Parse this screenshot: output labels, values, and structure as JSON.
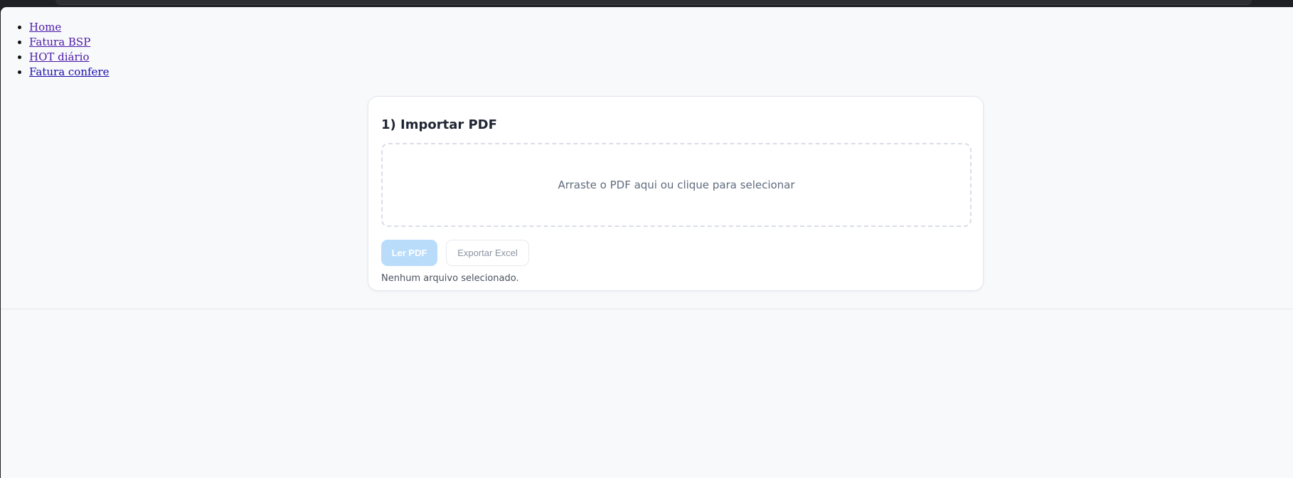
{
  "nav": {
    "items": [
      {
        "label": "Home"
      },
      {
        "label": "Fatura BSP"
      },
      {
        "label": "HOT diário"
      },
      {
        "label": "Fatura confere"
      }
    ]
  },
  "import_card": {
    "title": "1) Importar PDF",
    "dropzone_text": "Arraste o PDF aqui ou clique para selecionar",
    "read_button": "Ler PDF",
    "export_button": "Exportar Excel",
    "status": "Nenhum arquivo selecionado."
  },
  "colors": {
    "page_background": "#f8f9fb",
    "primary_disabled": "#b9dcfb",
    "link": "#1a0dab"
  }
}
